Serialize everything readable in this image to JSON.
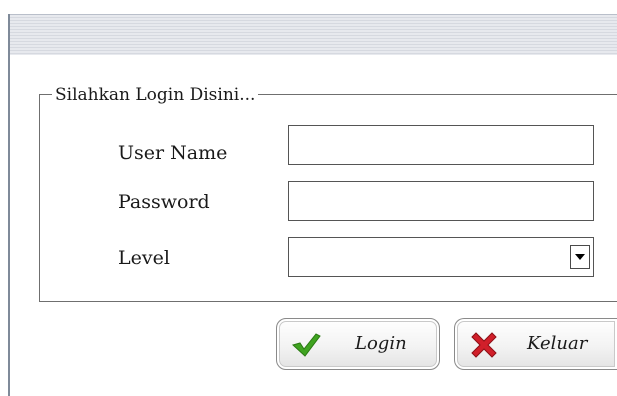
{
  "form": {
    "group_title": "Silahkan Login Disini...",
    "fields": [
      {
        "label": "User Name",
        "value": ""
      },
      {
        "label": "Password",
        "value": ""
      },
      {
        "label": "Level",
        "value": ""
      }
    ]
  },
  "buttons": {
    "login_label": "Login",
    "keluar_label": "Keluar"
  },
  "icons": {
    "login": "checkmark-icon",
    "keluar": "x-icon"
  },
  "colors": {
    "check_green": "#3fa320",
    "x_red": "#d11f2a"
  }
}
